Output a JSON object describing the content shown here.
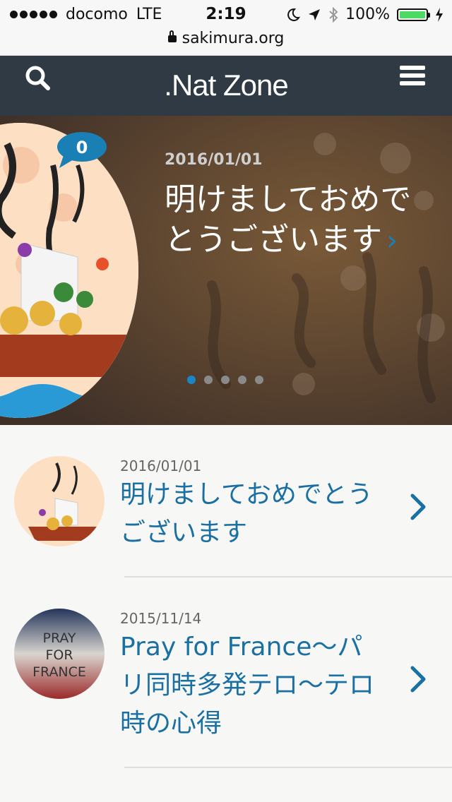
{
  "status_bar": {
    "carrier": "docomo",
    "network": "LTE",
    "time": "2:19",
    "battery": "100%"
  },
  "browser": {
    "url": "sakimura.org"
  },
  "header": {
    "site_title": ".Nat Zone"
  },
  "hero": {
    "comment_count": "0",
    "date": "2016/01/01",
    "title": "明けましておめでとうございます",
    "chevron": "›",
    "slide_count": 5,
    "active_slide": 1
  },
  "posts": [
    {
      "date": "2016/01/01",
      "title": "明けましておめでとうございます"
    },
    {
      "date": "2015/11/14",
      "title": "Pray for France〜パリ同時多発テロ〜テロ時の心得"
    }
  ],
  "pray_thumb_text": [
    "PRAY",
    "FOR",
    "FRANCE"
  ],
  "colors": {
    "header_bg": "#2f3a44",
    "accent": "#1a6fa3",
    "pager_active": "#1a86c5"
  },
  "icons": [
    "search-icon",
    "menu-icon",
    "lock-icon",
    "battery-icon",
    "chevron-right-icon"
  ]
}
